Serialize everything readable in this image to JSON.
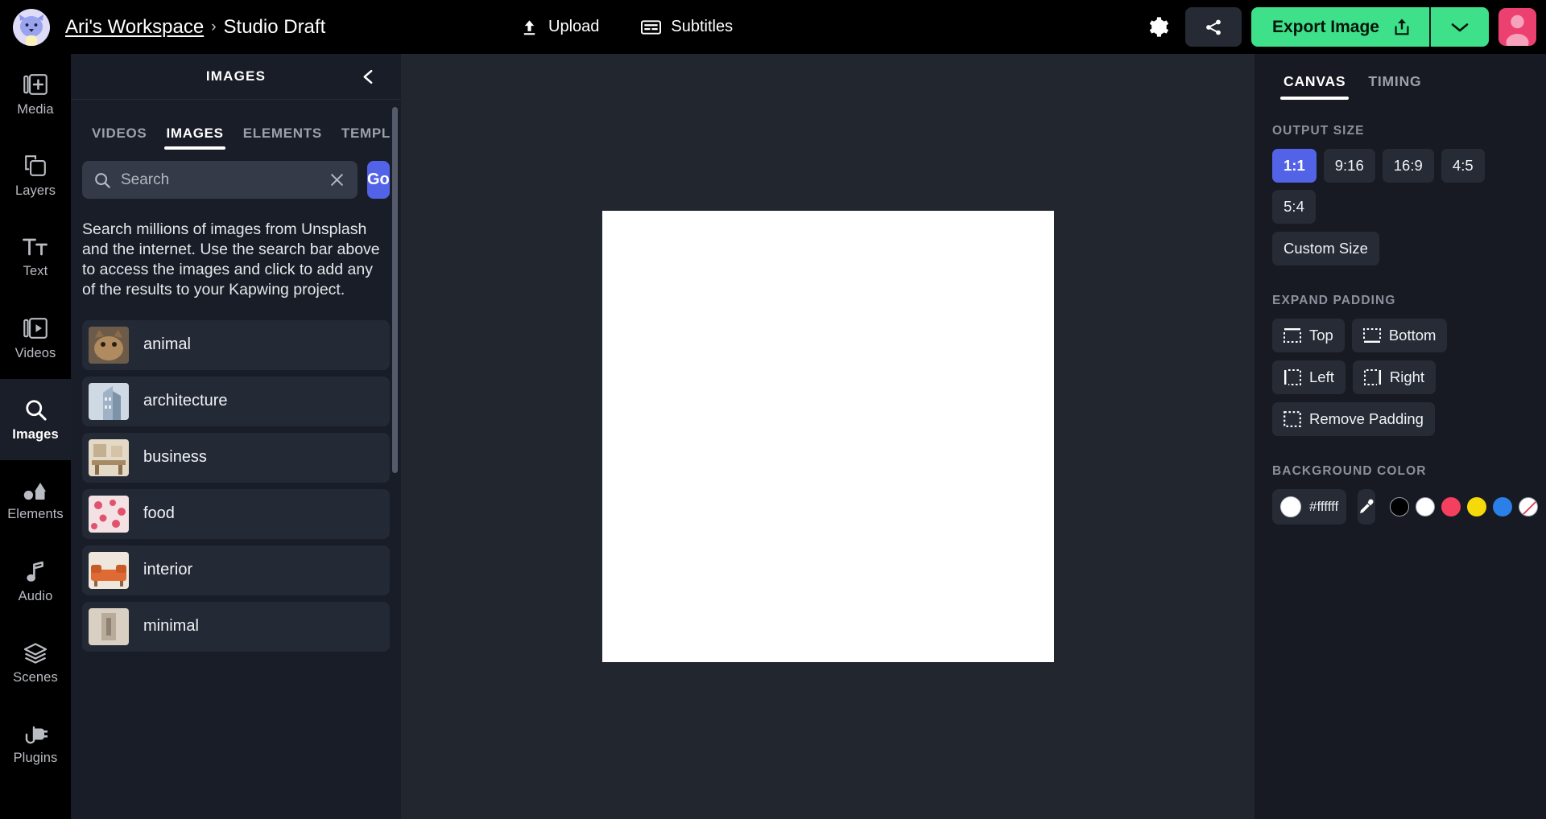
{
  "header": {
    "workspace_link": "Ari's Workspace",
    "breadcrumb_separator": "›",
    "project_title": "Studio Draft",
    "upload_label": "Upload",
    "subtitles_label": "Subtitles",
    "settings_icon": "gear-icon",
    "share_icon": "share-icon",
    "export_label": "Export Image",
    "export_icon": "share-export-icon",
    "export_caret_icon": "chevron-down-icon",
    "avatar_icon": "user-avatar",
    "accent_green": "#3ee089",
    "avatar_pink": "#ec4071"
  },
  "rail": {
    "items": [
      {
        "label": "Media",
        "icon": "media-add-icon",
        "active": false
      },
      {
        "label": "Layers",
        "icon": "layers-icon",
        "active": false
      },
      {
        "label": "Text",
        "icon": "text-icon",
        "active": false
      },
      {
        "label": "Videos",
        "icon": "video-icon",
        "active": false
      },
      {
        "label": "Images",
        "icon": "search-icon",
        "active": true
      },
      {
        "label": "Elements",
        "icon": "shapes-icon",
        "active": false
      },
      {
        "label": "Audio",
        "icon": "music-note-icon",
        "active": false
      },
      {
        "label": "Scenes",
        "icon": "stack-icon",
        "active": false
      },
      {
        "label": "Plugins",
        "icon": "plug-icon",
        "active": false
      }
    ]
  },
  "panel": {
    "title": "IMAGES",
    "collapse_icon": "chevron-left-icon",
    "tabs": [
      {
        "label": "VIDEOS",
        "active": false
      },
      {
        "label": "IMAGES",
        "active": true
      },
      {
        "label": "ELEMENTS",
        "active": false
      },
      {
        "label": "TEMPL",
        "active": false
      }
    ],
    "search": {
      "icon": "search-icon",
      "placeholder": "Search",
      "value": "",
      "clear_icon": "close-icon",
      "go_label": "Go"
    },
    "description": "Search millions of images from Unsplash and the internet. Use the search bar above to access the images and click to add any of the results to your Kapwing project.",
    "categories": [
      {
        "label": "animal",
        "thumb": "animal-thumb"
      },
      {
        "label": "architecture",
        "thumb": "architecture-thumb"
      },
      {
        "label": "business",
        "thumb": "business-thumb"
      },
      {
        "label": "food",
        "thumb": "food-thumb"
      },
      {
        "label": "interior",
        "thumb": "interior-thumb"
      },
      {
        "label": "minimal",
        "thumb": "minimal-thumb"
      }
    ]
  },
  "stage": {
    "canvas_background": "#ffffff"
  },
  "inspector": {
    "tabs": [
      {
        "label": "CANVAS",
        "active": true
      },
      {
        "label": "TIMING",
        "active": false
      }
    ],
    "output_size": {
      "title": "OUTPUT SIZE",
      "ratios": [
        {
          "label": "1:1",
          "selected": true
        },
        {
          "label": "9:16",
          "selected": false
        },
        {
          "label": "16:9",
          "selected": false
        },
        {
          "label": "4:5",
          "selected": false
        },
        {
          "label": "5:4",
          "selected": false
        }
      ],
      "custom_label": "Custom Size"
    },
    "expand_padding": {
      "title": "EXPAND PADDING",
      "buttons": [
        {
          "label": "Top",
          "icon": "pad-top-icon"
        },
        {
          "label": "Bottom",
          "icon": "pad-bottom-icon"
        },
        {
          "label": "Left",
          "icon": "pad-left-icon"
        },
        {
          "label": "Right",
          "icon": "pad-right-icon"
        },
        {
          "label": "Remove Padding",
          "icon": "pad-none-icon"
        }
      ]
    },
    "background_color": {
      "title": "BACKGROUND COLOR",
      "hex": "#ffffff",
      "eyedropper_icon": "eyedropper-icon",
      "swatches": [
        "#000000",
        "#ffffff",
        "#f43f5e",
        "#f5d90a",
        "#2a7fe8",
        "transparent"
      ]
    }
  }
}
